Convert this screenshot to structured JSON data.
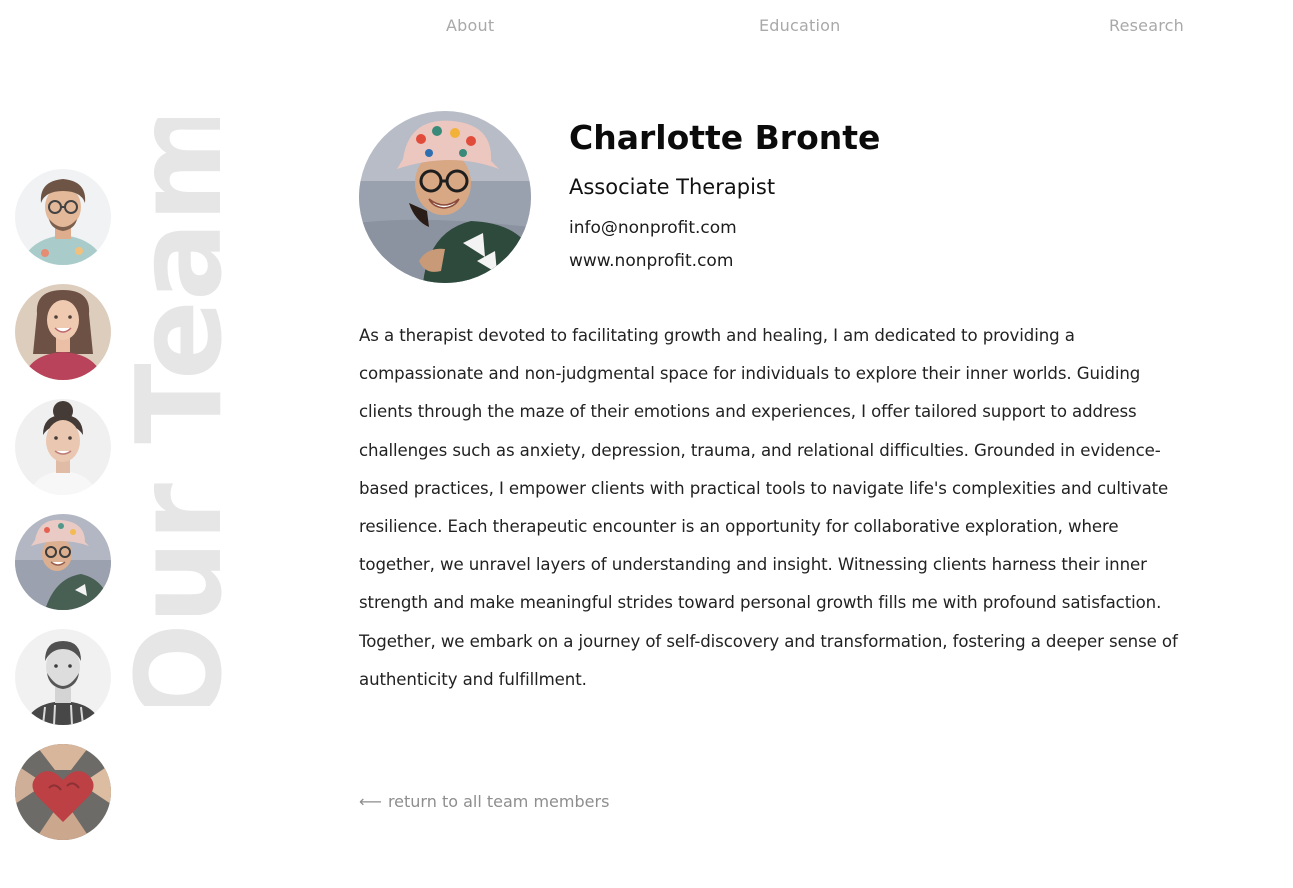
{
  "nav": {
    "items": [
      {
        "label": "About"
      },
      {
        "label": "Education"
      },
      {
        "label": "Research"
      }
    ]
  },
  "sidebar": {
    "title": "Our Team",
    "avatars": [
      {
        "icon": "man-curly-hair-glasses-avatar"
      },
      {
        "icon": "woman-red-top-avatar"
      },
      {
        "icon": "woman-hair-bun-avatar"
      },
      {
        "icon": "woman-bucket-hat-avatar"
      },
      {
        "icon": "man-beard-avatar"
      },
      {
        "icon": "hands-heart-avatar"
      }
    ]
  },
  "profile": {
    "name": "Charlotte Bronte",
    "role": "Associate Therapist",
    "email": "info@nonprofit.com",
    "website": "www.nonprofit.com",
    "photo_icon": "woman-bucket-hat-portrait",
    "bio": "As a therapist devoted to facilitating growth and healing, I am dedicated to providing a compassionate and non-judgmental space for individuals to explore their inner worlds. Guiding clients through the maze of their emotions and experiences, I offer tailored support to address challenges such as anxiety, depression, trauma, and relational difficulties. Grounded in evidence-based practices, I empower clients with practical tools to navigate life's complexities and cultivate resilience. Each therapeutic encounter is an opportunity for collaborative exploration, where together, we unravel layers of understanding and insight. Witnessing clients harness their inner strength and make meaningful strides toward personal growth fills me with profound satisfaction. Together, we embark on a journey of self-discovery and transformation, fostering a deeper sense of authenticity and fulfillment."
  },
  "return_link": {
    "arrow": "⟵",
    "label": "return to all team members"
  },
  "colors": {
    "nav_text": "#a9a9a9",
    "vertical_title": "#e6e6e6",
    "body_text": "#222222",
    "muted_link": "#8e8e8e"
  }
}
